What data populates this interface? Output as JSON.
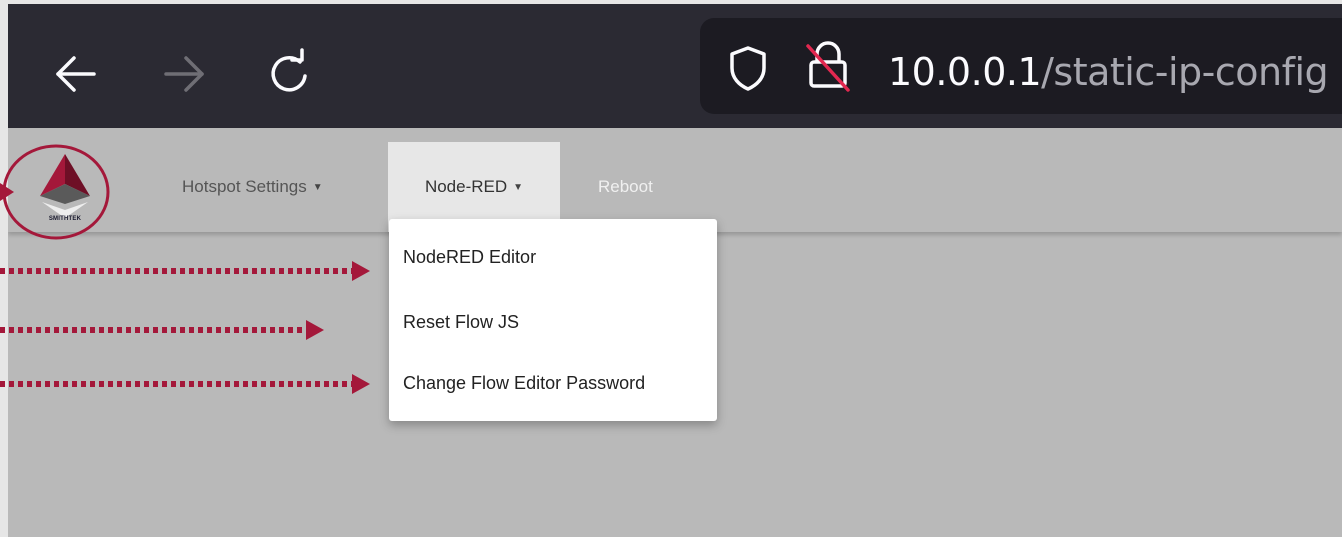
{
  "browser": {
    "url_host": "10.0.0.1",
    "url_path": "/static-ip-config"
  },
  "logo": {
    "text": "SMITHTEK"
  },
  "navbar": {
    "items": [
      {
        "label": "Hotspot Settings"
      },
      {
        "label": "Node-RED"
      },
      {
        "label": "Reboot"
      }
    ]
  },
  "dropdown": {
    "items": [
      {
        "label": "NodeRED Editor"
      },
      {
        "label": "Reset Flow JS"
      },
      {
        "label": "Change Flow Editor Password"
      }
    ]
  },
  "annotation_color": "#a4183a"
}
